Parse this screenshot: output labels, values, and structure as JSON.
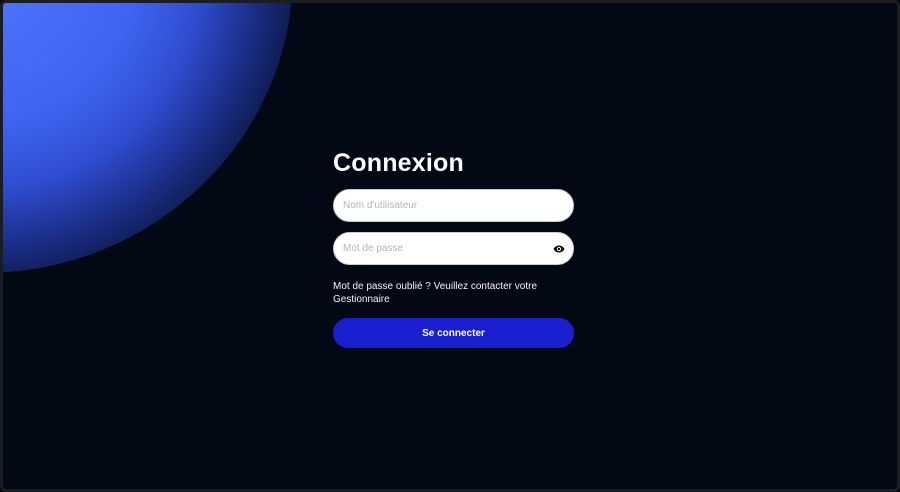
{
  "login": {
    "title": "Connexion",
    "username": {
      "value": "",
      "placeholder": "Nom d'utilisateur"
    },
    "password": {
      "value": "",
      "placeholder": "Mot de passe",
      "toggle_icon": "eye-icon"
    },
    "forgot_text": "Mot de passe oublié ? Veuillez contacter votre Gestionnaire",
    "submit_label": "Se connecter"
  },
  "colors": {
    "background": "#020915",
    "glow": "#3f64f2",
    "button": "#1a1fcf",
    "text": "#ffffff"
  }
}
